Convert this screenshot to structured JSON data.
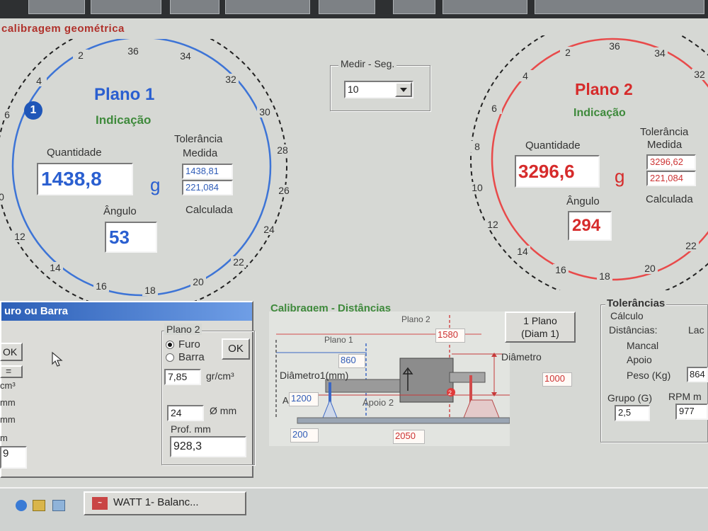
{
  "window": {
    "panel_title": "calibragem geométrica"
  },
  "plano1": {
    "title": "Plano 1",
    "indicacao": "Indicação",
    "quantidade_label": "Quantidade",
    "quantidade": "1438,8",
    "unit": "g",
    "tolerancia_label": "Tolerância",
    "medida_label": "Medida",
    "medida": "1438,81",
    "calculada_value": "221,084",
    "calculada_label": "Calculada",
    "angulo_label": "Ângulo",
    "angulo": "53",
    "marker": "1",
    "scale": [
      "36",
      "34",
      "32",
      "30",
      "28",
      "26",
      "24",
      "22",
      "20",
      "18",
      "16",
      "14",
      "12",
      "0",
      "6",
      "4",
      "2"
    ],
    "color": "#3d74d6"
  },
  "plano2": {
    "title": "Plano 2",
    "indicacao": "Indicação",
    "quantidade_label": "Quantidade",
    "quantidade": "3296,6",
    "unit": "g",
    "tolerancia_label": "Tolerância",
    "medida_label": "Medida",
    "medida": "3296,62",
    "calculada_value": "221,084",
    "calculada_label": "Calculada",
    "angulo_label": "Ângulo",
    "angulo": "294",
    "scale": [
      "2",
      "36",
      "34",
      "32",
      "4",
      "6",
      "8",
      "10",
      "12",
      "14",
      "16",
      "18",
      "20",
      "22"
    ],
    "color": "#e84a4a"
  },
  "medir": {
    "title": "Medir - Seg.",
    "value": "10"
  },
  "dialog": {
    "title": "uro ou Barra",
    "ok_left": "OK",
    "eq_button": "=",
    "units": [
      "cm³",
      "mm",
      "mm",
      "m"
    ],
    "left_value": "9",
    "plano2_group": "Plano 2",
    "opt_furo": "Furo",
    "opt_barra": "Barra",
    "ok": "OK",
    "density": "7,85",
    "density_unit": "gr/cm³",
    "diameter": "24",
    "diameter_unit": "Ø mm",
    "prof_label": "Prof. mm",
    "prof": "928,3"
  },
  "dist": {
    "title": "Calibragem - Distâncias",
    "plano1": "Plano 1",
    "plano2": "Plano 2",
    "v1580": "1580",
    "v860": "860",
    "diam1_label": "Diâmetro1(mm)",
    "v1200": "1200",
    "a_label": "A",
    "apoio2": "Apoio 2",
    "v200": "200",
    "v2050": "2050",
    "um_plano": "1 Plano",
    "diam1_btn": "(Diam 1)",
    "diametro": "Diâmetro",
    "v1000": "1000"
  },
  "tol": {
    "title": "Tolerâncias",
    "calculo": "Cálculo",
    "distancias": "Distâncias:",
    "lac": "Lac",
    "mancal": "Mancal",
    "apoio": "Apoio",
    "peso": "Peso (Kg)",
    "peso_value": "864",
    "grupo": "Grupo (G)",
    "grupo_value": "2,5",
    "rpm": "RPM m",
    "rpm_value": "977"
  },
  "taskbar": {
    "task_label": "WATT 1- Balanc..."
  }
}
